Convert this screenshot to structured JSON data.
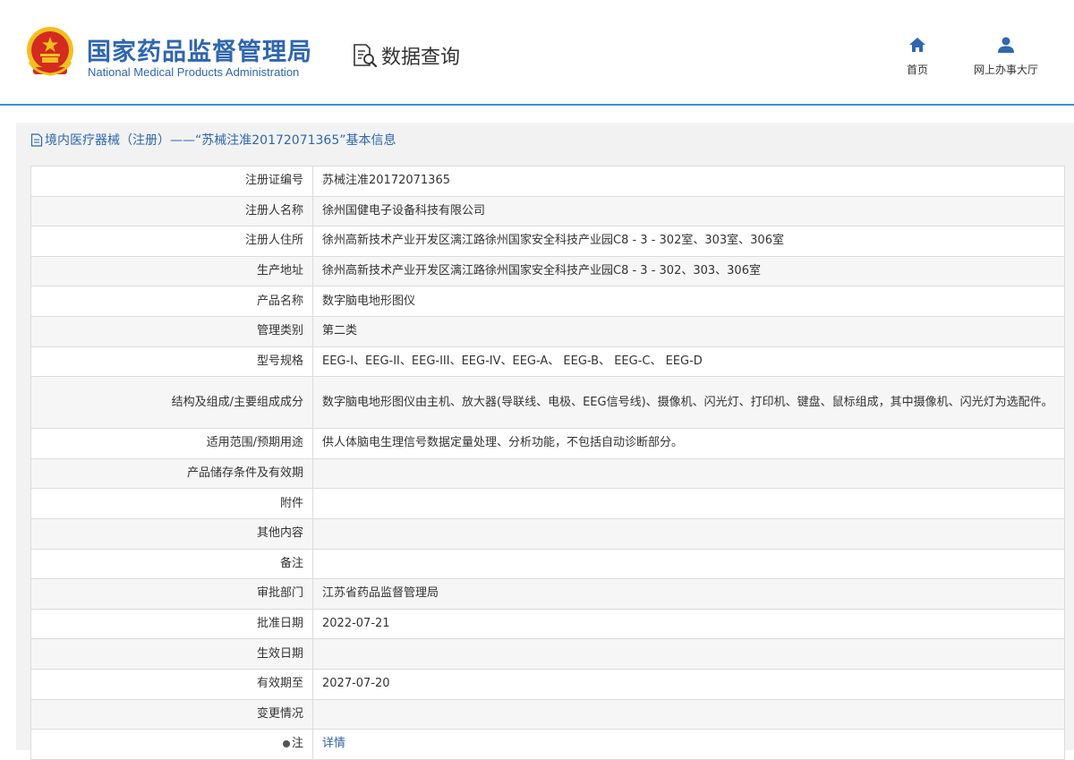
{
  "header": {
    "org_name_cn": "国家药品监督管理局",
    "org_name_en": "National Medical Products Administration",
    "query_label": "数据查询",
    "nav": {
      "home_label": "首页",
      "hall_label": "网上办事大厅"
    }
  },
  "panel": {
    "title_prefix": "境内医疗器械（注册）——",
    "title_main": "“苏械注准20172071365”基本信息"
  },
  "rows": [
    {
      "key": "注册证编号",
      "value": "苏械注准20172071365"
    },
    {
      "key": "注册人名称",
      "value": "徐州国健电子设备科技有限公司"
    },
    {
      "key": "注册人住所",
      "value": "徐州高新技术产业开发区漓江路徐州国家安全科技产业园C8 - 3 - 302室、303室、306室"
    },
    {
      "key": "生产地址",
      "value": "徐州高新技术产业开发区漓江路徐州国家安全科技产业园C8 - 3 - 302、303、306室"
    },
    {
      "key": "产品名称",
      "value": "数字脑电地形图仪"
    },
    {
      "key": "管理类别",
      "value": "第二类"
    },
    {
      "key": "型号规格",
      "value": "EEG-I、EEG-II、EEG-III、EEG-IV、EEG-A、 EEG-B、 EEG-C、 EEG-D"
    },
    {
      "key": "结构及组成/主要组成成分",
      "value": "数字脑电地形图仪由主机、放大器(导联线、电极、EEG信号线)、摄像机、闪光灯、打印机、键盘、鼠标组成，其中摄像机、闪光灯为选配件。"
    },
    {
      "key": "适用范围/预期用途",
      "value": "供人体脑电生理信号数据定量处理、分析功能，不包括自动诊断部分。"
    },
    {
      "key": "产品储存条件及有效期",
      "value": ""
    },
    {
      "key": "附件",
      "value": ""
    },
    {
      "key": "其他内容",
      "value": ""
    },
    {
      "key": "备注",
      "value": ""
    },
    {
      "key": "审批部门",
      "value": "江苏省药品监督管理局"
    },
    {
      "key": "批准日期",
      "value": "2022-07-21"
    },
    {
      "key": "生效日期",
      "value": ""
    },
    {
      "key": "有效期至",
      "value": "2027-07-20"
    },
    {
      "key": "变更情况",
      "value": ""
    },
    {
      "key": "注",
      "value": "详情"
    }
  ],
  "colors": {
    "brand_blue": "#2f66b0",
    "rule_blue": "#3d8fd6",
    "emblem_red": "#d42a20",
    "emblem_gold": "#f2c01e"
  },
  "icons": {
    "emblem": "national-emblem",
    "query": "document-search-icon",
    "home": "home-icon",
    "hall": "user-icon",
    "title": "document-icon",
    "note": "pin-icon"
  }
}
